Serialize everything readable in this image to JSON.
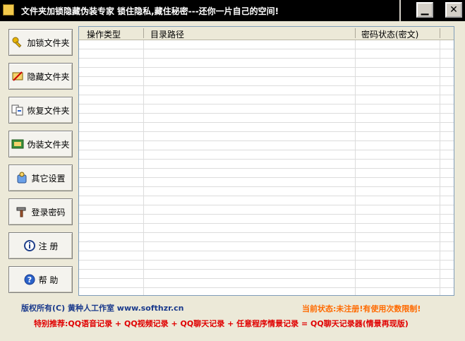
{
  "window": {
    "title": "文件夹加锁隐藏伪装专家 锁住隐私,藏住秘密---还你一片自己的空间!",
    "minimize_label": "▁",
    "close_label": "✕"
  },
  "sidebar": {
    "items": [
      {
        "label": "加锁文件夹",
        "icon": "key-icon"
      },
      {
        "label": "隐藏文件夹",
        "icon": "hide-icon"
      },
      {
        "label": "恢复文件夹",
        "icon": "restore-icon"
      },
      {
        "label": "伪装文件夹",
        "icon": "disguise-icon"
      },
      {
        "label": "其它设置",
        "icon": "settings-icon"
      },
      {
        "label": "登录密码",
        "icon": "password-icon"
      },
      {
        "label": "注 册",
        "icon": "info-icon"
      },
      {
        "label": "帮 助",
        "icon": "help-icon"
      }
    ]
  },
  "table": {
    "columns": [
      "操作类型",
      "目录路径",
      "密码状态(密文)"
    ],
    "rows": []
  },
  "footer": {
    "copyright": "版权所有(C)  黄种人工作室 www.softhzr.cn",
    "status": "当前状态:未注册!有使用次数限制!",
    "recommend": "特别推荐:QQ语音记录 + QQ视频记录 + QQ聊天记录 + 任意程序情景记录 = QQ聊天记录器(情景再现版)"
  },
  "colors": {
    "title_bar": "#000000",
    "copyright_text": "#1a3a8c",
    "status_text": "#ff6a00",
    "recommend_text": "#e00000"
  }
}
